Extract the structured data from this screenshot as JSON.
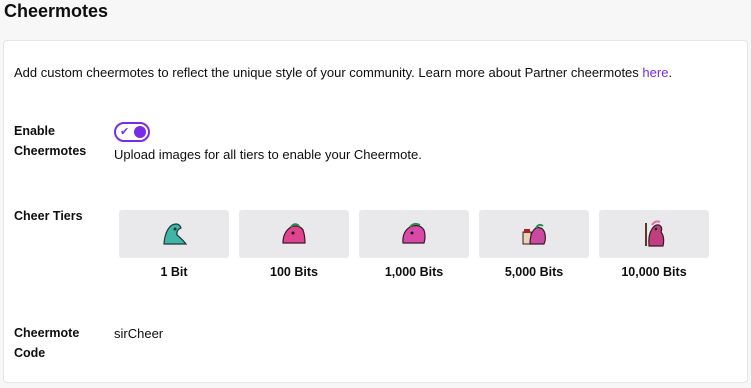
{
  "page": {
    "title": "Cheermotes"
  },
  "intro": {
    "text": "Add custom cheermotes to reflect the unique style of your community. Learn more about Partner cheermotes ",
    "link": "here",
    "suffix": "."
  },
  "enable": {
    "label_line1": "Enable",
    "label_line2": "Cheermotes",
    "toggle_on": true,
    "help": "Upload images for all tiers to enable your Cheermote."
  },
  "tiers": {
    "label": "Cheer Tiers",
    "items": [
      {
        "label": "1 Bit",
        "icon": "cheer-emote-icon",
        "color": "#3fb5a7"
      },
      {
        "label": "100 Bits",
        "icon": "cheer-emote-icon",
        "color": "#e0448f"
      },
      {
        "label": "1,000 Bits",
        "icon": "cheer-emote-icon",
        "color": "#d84aa8"
      },
      {
        "label": "5,000 Bits",
        "icon": "cheer-emote-icon",
        "color": "#c94aa0"
      },
      {
        "label": "10,000 Bits",
        "icon": "cheer-emote-icon",
        "color": "#c0407f"
      }
    ]
  },
  "code": {
    "label_line1": "Cheermote",
    "label_line2": "Code",
    "value": "sirCheer"
  },
  "colors": {
    "accent": "#772ce8",
    "tile_bg": "#e9e9ec"
  }
}
